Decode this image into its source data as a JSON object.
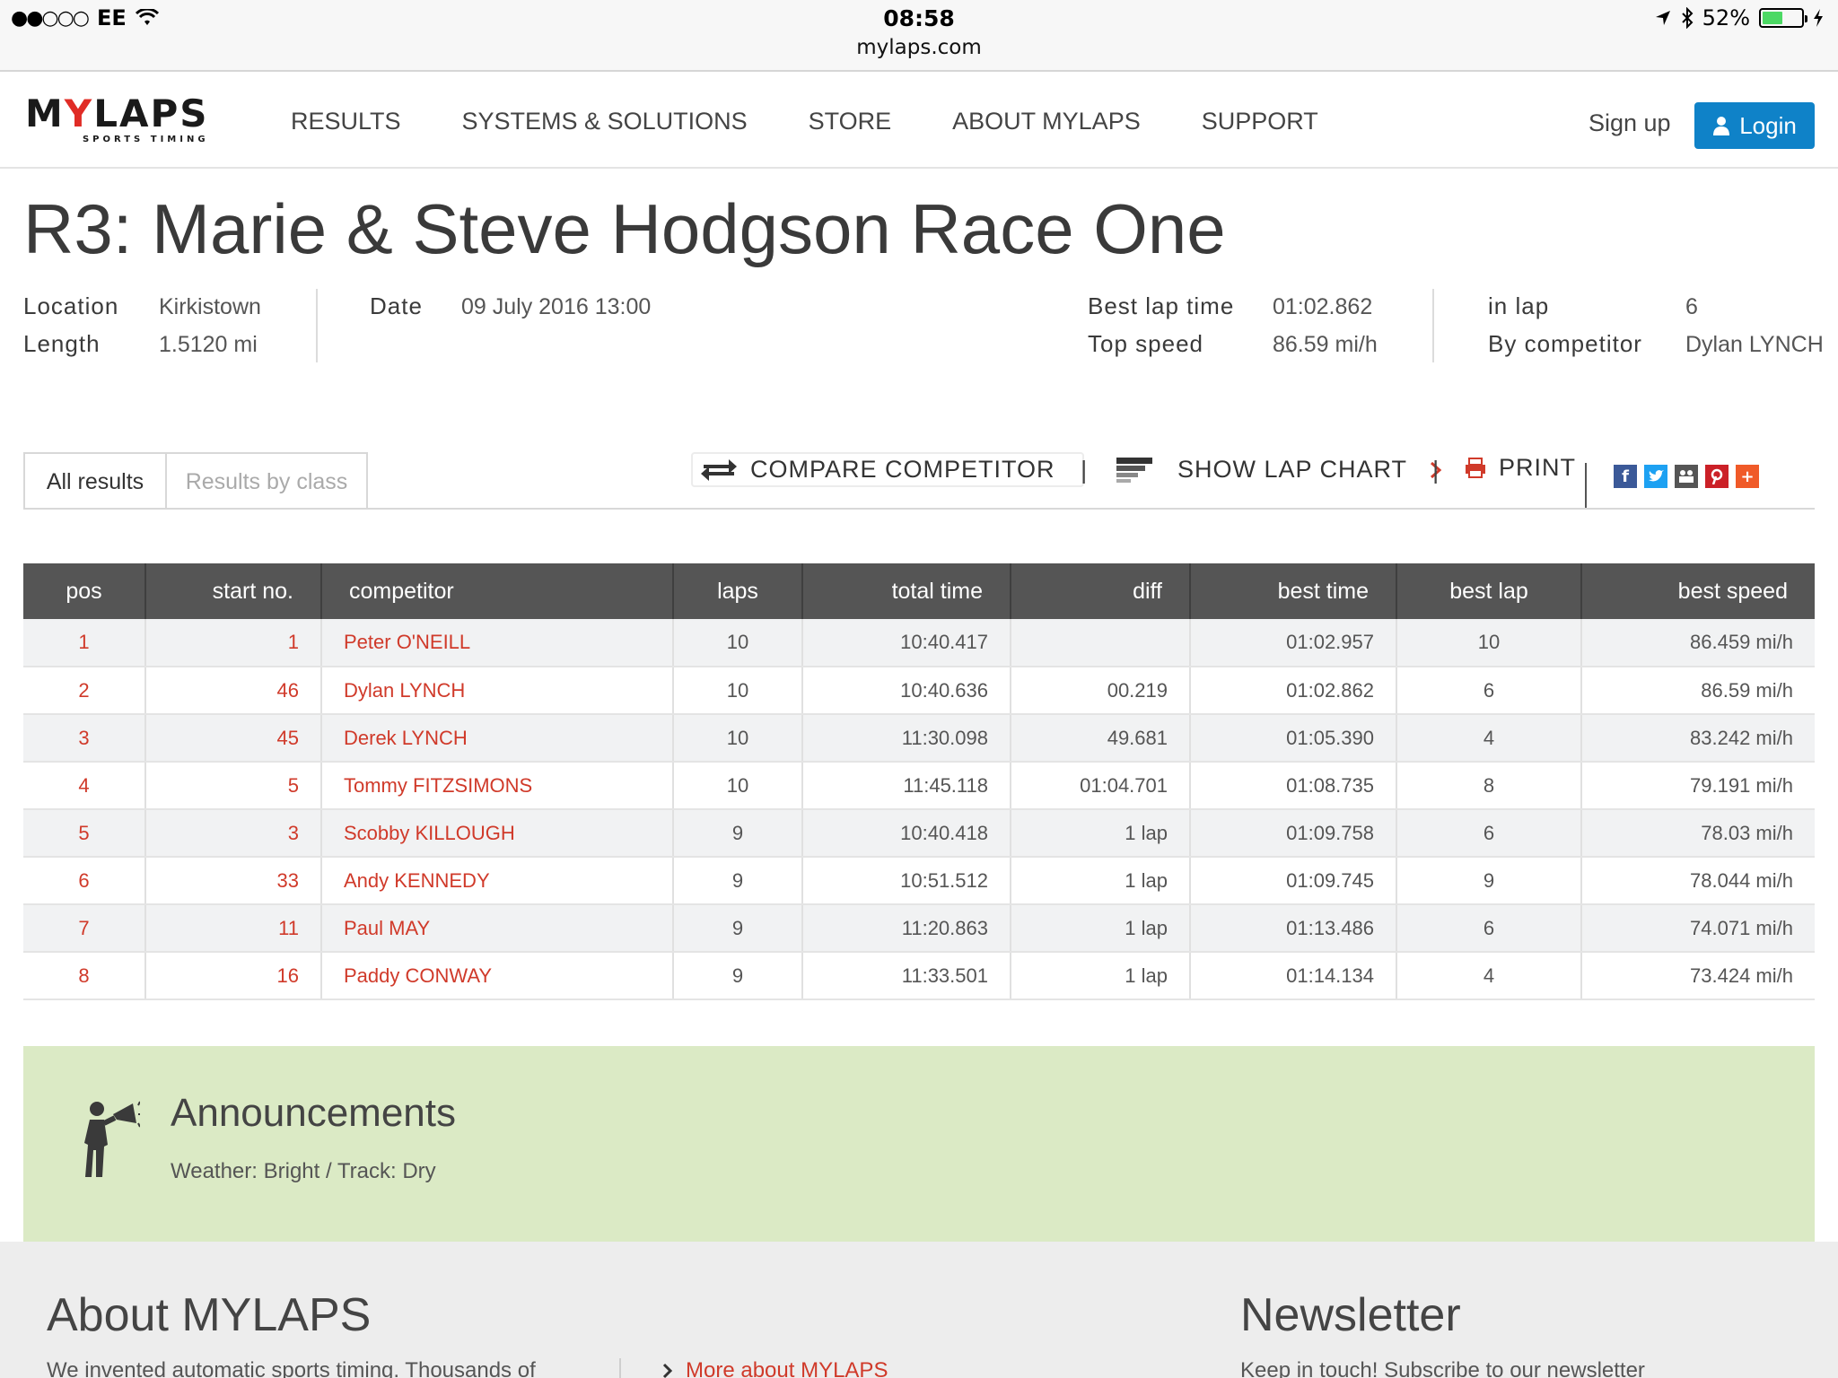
{
  "status_bar": {
    "signal": "●●○○○",
    "carrier": "EE",
    "time": "08:58",
    "url": "mylaps.com",
    "battery": "52%",
    "battery_level": 0.52
  },
  "header": {
    "logo": "MYLAPS",
    "logo_sub": "SPORTS TIMING",
    "nav": [
      "RESULTS",
      "SYSTEMS & SOLUTIONS",
      "STORE",
      "ABOUT MYLAPS",
      "SUPPORT"
    ],
    "signup": "Sign up",
    "login": "Login",
    "accent": "#0f82c8"
  },
  "race": {
    "title": "R3: Marie & Steve Hodgson Race One",
    "location_label": "Location",
    "location": "Kirkistown",
    "length_label": "Length",
    "length": "1.5120 mi",
    "date_label": "Date",
    "date": "09 July 2016 13:00",
    "best_lap_time_label": "Best lap time",
    "best_lap_time": "01:02.862",
    "top_speed_label": "Top speed",
    "top_speed": "86.59 mi/h",
    "in_lap_label": "in lap",
    "in_lap": "6",
    "by_competitor_label": "By competitor",
    "by_competitor": "Dylan LYNCH"
  },
  "tabs": {
    "all_results": "All results",
    "results_by_class": "Results by class"
  },
  "toolbar": {
    "compare": "COMPARE COMPETITOR",
    "lap_chart": "SHOW LAP CHART",
    "print": "PRINT",
    "pipe": "|"
  },
  "social": {
    "facebook": "f",
    "plus": "+"
  },
  "table": {
    "headers": [
      "pos",
      "start no.",
      "competitor",
      "laps",
      "total time",
      "diff",
      "best time",
      "best lap",
      "best speed"
    ],
    "rows": [
      [
        "1",
        "1",
        "Peter O'NEILL",
        "10",
        "10:40.417",
        "",
        "01:02.957",
        "10",
        "86.459 mi/h"
      ],
      [
        "2",
        "46",
        "Dylan LYNCH",
        "10",
        "10:40.636",
        "00.219",
        "01:02.862",
        "6",
        "86.59 mi/h"
      ],
      [
        "3",
        "45",
        "Derek LYNCH",
        "10",
        "11:30.098",
        "49.681",
        "01:05.390",
        "4",
        "83.242 mi/h"
      ],
      [
        "4",
        "5",
        "Tommy FITZSIMONS",
        "10",
        "11:45.118",
        "01:04.701",
        "01:08.735",
        "8",
        "79.191 mi/h"
      ],
      [
        "5",
        "3",
        "Scobby KILLOUGH",
        "9",
        "10:40.418",
        "1 lap",
        "01:09.758",
        "6",
        "78.03 mi/h"
      ],
      [
        "6",
        "33",
        "Andy KENNEDY",
        "9",
        "10:51.512",
        "1 lap",
        "01:09.745",
        "9",
        "78.044 mi/h"
      ],
      [
        "7",
        "11",
        "Paul MAY",
        "9",
        "11:20.863",
        "1 lap",
        "01:13.486",
        "6",
        "74.071 mi/h"
      ],
      [
        "8",
        "16",
        "Paddy CONWAY",
        "9",
        "11:33.501",
        "1 lap",
        "01:14.134",
        "4",
        "73.424 mi/h"
      ]
    ]
  },
  "announcements": {
    "title": "Announcements",
    "text": "Weather: Bright / Track: Dry"
  },
  "footer": {
    "about_title": "About MYLAPS",
    "about_text": "We invented automatic sports timing. Thousands of",
    "more_link": "More about MYLAPS",
    "newsletter_title": "Newsletter",
    "newsletter_text": "Keep in touch! Subscribe to our newsletter"
  }
}
